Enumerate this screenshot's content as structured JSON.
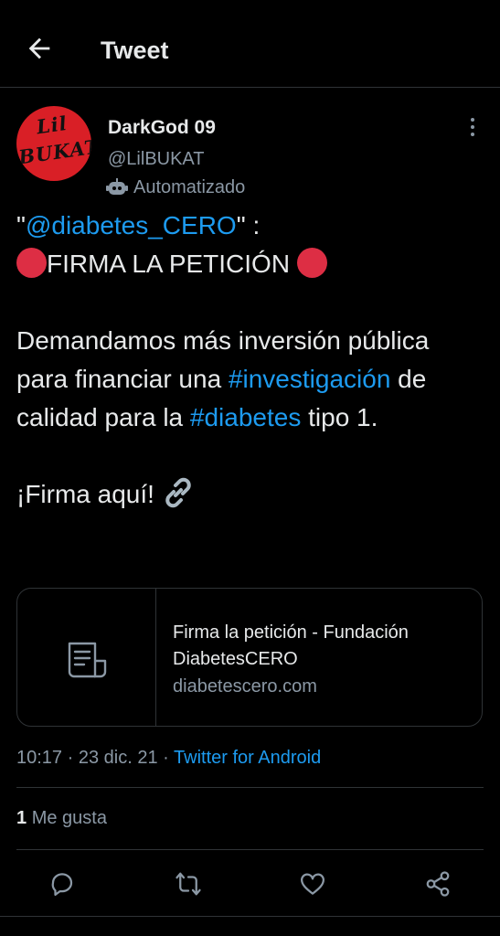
{
  "header": {
    "title": "Tweet",
    "back_icon": "arrow-left-icon"
  },
  "author": {
    "avatar_text_line1": "Lil",
    "avatar_text_line2": "BUKAT",
    "display_name": "DarkGod 09",
    "handle": "@LilBUKAT",
    "automated_label": "Automatizado",
    "automated_icon": "robot-icon"
  },
  "tweet": {
    "mention": "@diabetes_CERO",
    "quote_open": "\"",
    "quote_close": "\" :",
    "headline": "FIRMA LA PETICIÓN",
    "body_part1": "Demandamos más inversión pública para financiar una",
    "hashtag1": "#investigación",
    "body_part2": "de calidad para la",
    "hashtag2": "#diabetes",
    "body_part3": "tipo 1.",
    "cta": "¡Firma aquí!"
  },
  "card": {
    "title": "Firma la petición - Fundación DiabetesCERO",
    "domain": "diabetescero.com",
    "icon": "document-icon"
  },
  "meta": {
    "time": "10:17",
    "date": "23 dic. 21",
    "separator": "·",
    "source": "Twitter for Android"
  },
  "stats": {
    "likes_count": "1",
    "likes_label": "Me gusta"
  },
  "actions": [
    "reply-icon",
    "retweet-icon",
    "like-icon",
    "share-icon"
  ],
  "colors": {
    "background": "#000000",
    "text": "#e7e9ea",
    "secondary": "#8b98a5",
    "accent": "#1d9bf0",
    "divider": "#2f3336",
    "emoji_red": "#dd2e44"
  }
}
